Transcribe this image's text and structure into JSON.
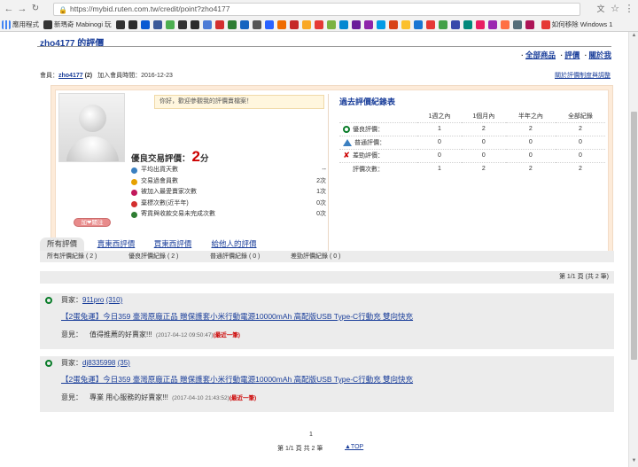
{
  "browser": {
    "url": "https://mybid.ruten.com.tw/credit/point?zho4177",
    "bookmarks": [
      "應用程式",
      "新瑪奇 Mabinogi 玩",
      "如何移除 Windows 1"
    ],
    "bookmark_icon_colors": [
      "#333333",
      "#2c2c2c",
      "#0a5bd3",
      "#3b5998",
      "#4caf50",
      "#333333",
      "#2c2c2c",
      "#4c7bd6",
      "#d32f2f",
      "#2e7d32",
      "#1565c0",
      "#555555",
      "#2962ff",
      "#ef6c00",
      "#c62828",
      "#f9a825",
      "#e53935",
      "#7cb342",
      "#0288d1",
      "#6a1b9a",
      "#8e24aa",
      "#039be5",
      "#d84315",
      "#fbc02d",
      "#1976d2",
      "#e53935",
      "#43a047",
      "#3949ab",
      "#00897b",
      "#e91e63",
      "#9c27b0",
      "#ff7043",
      "#546e7a",
      "#ad1457"
    ]
  },
  "header": {
    "title": "zho4177 的評價",
    "links": [
      "全部商品",
      "評價",
      "關於我"
    ],
    "member_label": "會員：",
    "member_name": "zho4177",
    "member_score": "(2)",
    "join_label": "加入會員時間：2016-12-23",
    "rules_link": "關於評價制度與調整"
  },
  "panel": {
    "greeting": "你好，歡迎參觀我的評價賣檔案！",
    "add_friend": "加❤關注",
    "good_label": "優良交易評價：",
    "good_value": "2",
    "good_unit": "分",
    "stats": [
      {
        "label": "平均出貨天數",
        "value": "--",
        "color": "#3a7fc0"
      },
      {
        "label": "交易過會員數",
        "value": "2次",
        "color": "#e6a100"
      },
      {
        "label": "被加入最愛賣家次數",
        "value": "1次",
        "color": "#c2185b"
      },
      {
        "label": "棄標次數(近半年)",
        "value": "0次",
        "color": "#d32f2f"
      },
      {
        "label": "寄貨與收款交易未完成次數",
        "value": "0次",
        "color": "#2e7d32"
      }
    ],
    "past_title": "過去評價紀錄表",
    "past_headers": [
      "",
      "1週之內",
      "1個月內",
      "半年之內",
      "全部紀錄"
    ],
    "past_rows": [
      {
        "icon": "good",
        "label": "優良評價：",
        "values": [
          "1",
          "2",
          "2",
          "2"
        ]
      },
      {
        "icon": "normal",
        "label": "普通評價：",
        "values": [
          "0",
          "0",
          "0",
          "0"
        ]
      },
      {
        "icon": "bad",
        "label": "差勁評價：",
        "values": [
          "0",
          "0",
          "0",
          "0"
        ]
      },
      {
        "icon": "none",
        "label": "評價次數：",
        "values": [
          "1",
          "2",
          "2",
          "2"
        ]
      }
    ]
  },
  "tabs": [
    "所有評價",
    "賣東西評價",
    "買東西評價",
    "給他人的評價"
  ],
  "filters": {
    "all": "所有評價紀錄 ( 2 )",
    "good": "優良評價紀錄 ( 2 )",
    "normal": "普通評價紀錄 ( 0 )",
    "bad": "差勁評價紀錄 ( 0 )"
  },
  "pager": "第 1/1 頁 (共 2 筆)",
  "reviews": [
    {
      "buyer_label": "買家：",
      "buyer": "911pro",
      "buyer_score": "(310)",
      "title": "【2蛋兔運】今日359 臺灣原廠正品 贈保護套小米行動電源10000mAh 高配版USB Type-C行動充 雙向快充",
      "comment_label": "意見：",
      "comment": "值得推薦的好賣家!!!",
      "time": "(2017-04-12 09:50:47)",
      "recent": "(最近一筆)"
    },
    {
      "buyer_label": "買家：",
      "buyer": "dj8335998",
      "buyer_score": "(35)",
      "title": "【2蛋兔運】今日359 臺灣原廠正品 贈保護套小米行動電源10000mAh 高配版USB Type-C行動充 雙向快充",
      "comment_label": "意見：",
      "comment": "專業 用心服務的好賣家!!!",
      "time": "(2017-04-10 21:43:52)",
      "recent": "(最近一筆)"
    }
  ],
  "footer": {
    "page_number": "1",
    "page_info": "第 1/1 頁 共 2 筆",
    "top_link": "▲TOP"
  }
}
